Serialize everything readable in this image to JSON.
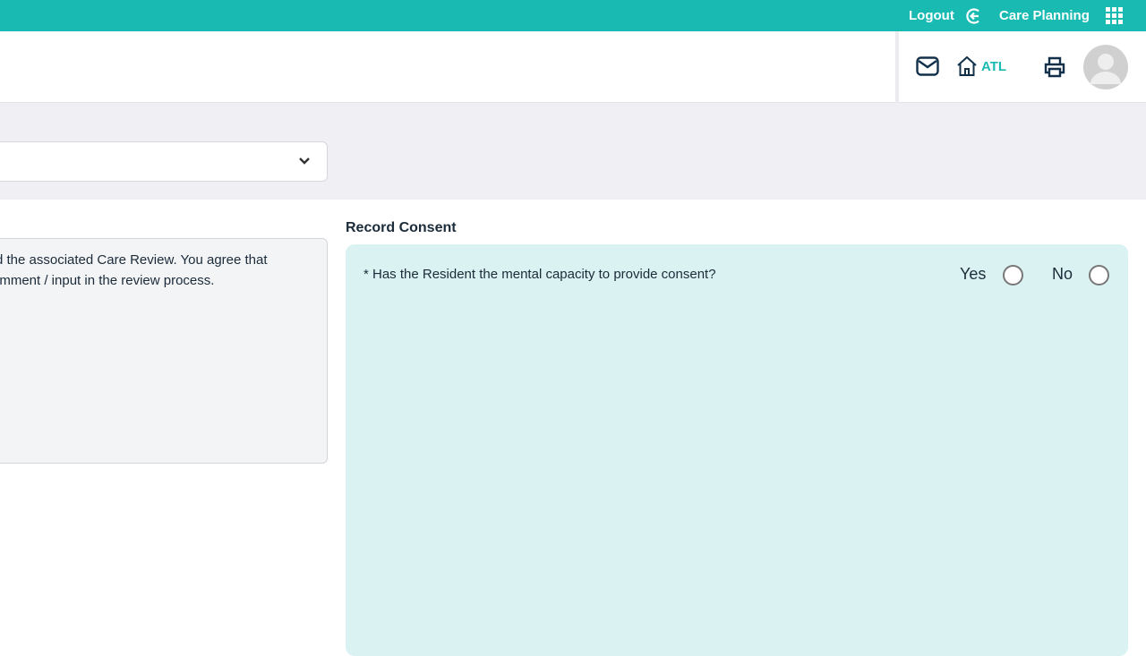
{
  "topbar": {
    "logout": "Logout",
    "app": "Care Planning"
  },
  "header": {
    "home_label": "ATL"
  },
  "notice": {
    "lines": [
      "d the associated Care Review.  You agree that",
      "omment / input in the review process."
    ]
  },
  "consent": {
    "title": "Record Consent",
    "question": "* Has the Resident the mental capacity to provide consent?",
    "yes": "Yes",
    "no": "No"
  },
  "colors": {
    "accent": "#19bab2",
    "panel": "#dbf2f2"
  }
}
